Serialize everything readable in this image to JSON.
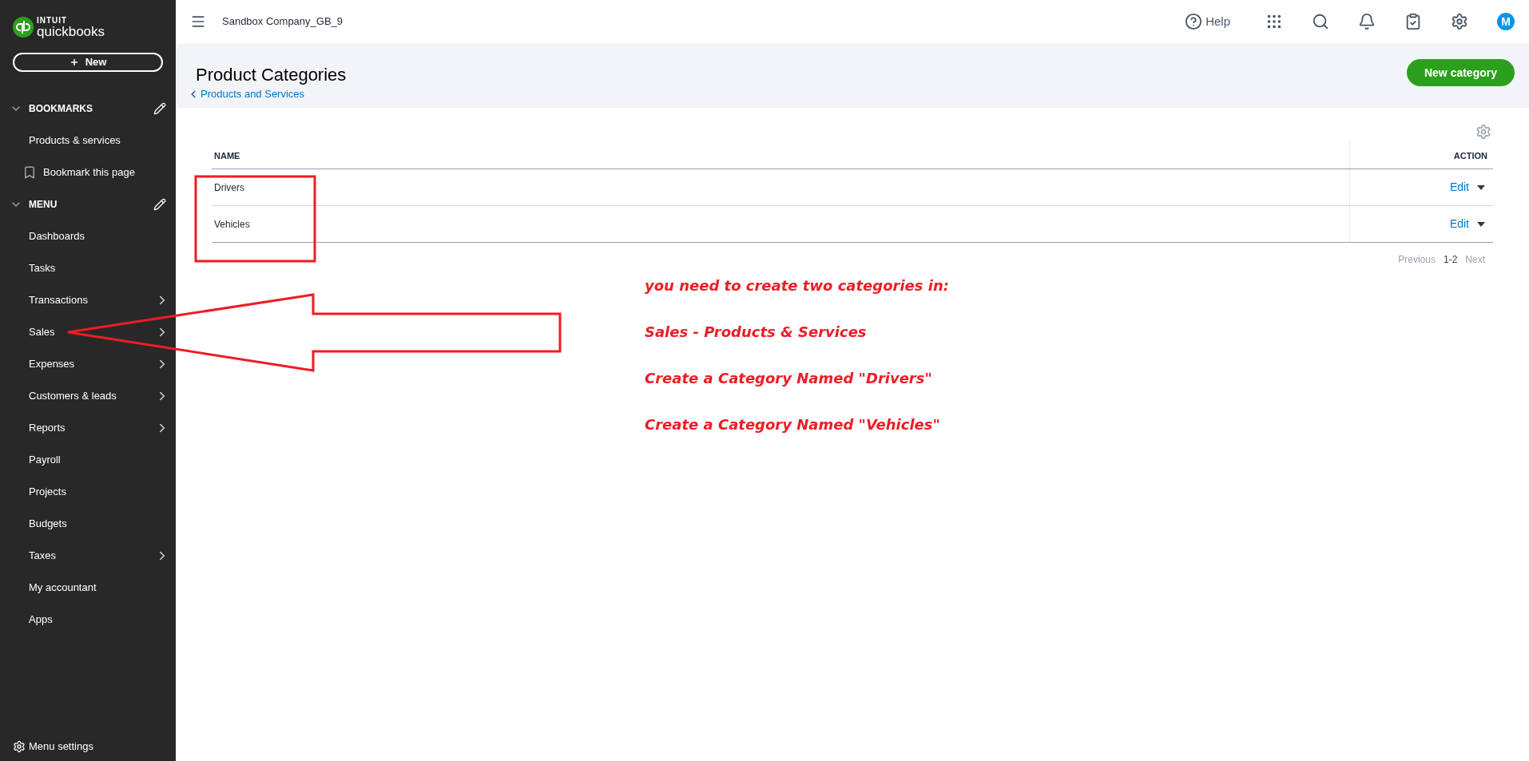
{
  "sidebar": {
    "logo": {
      "brand_top": "INTUIT",
      "brand": "quickbooks"
    },
    "new_button": "New",
    "bookmarks": {
      "title": "BOOKMARKS",
      "expanded": true,
      "items": [
        "Products & services"
      ],
      "bookmark_action": "Bookmark this page"
    },
    "menu": {
      "title": "MENU",
      "expanded": true,
      "items": [
        {
          "label": "Dashboards",
          "expandable": false
        },
        {
          "label": "Tasks",
          "expandable": false
        },
        {
          "label": "Transactions",
          "expandable": true
        },
        {
          "label": "Sales",
          "expandable": true
        },
        {
          "label": "Expenses",
          "expandable": true
        },
        {
          "label": "Customers & leads",
          "expandable": true
        },
        {
          "label": "Reports",
          "expandable": true
        },
        {
          "label": "Payroll",
          "expandable": false
        },
        {
          "label": "Projects",
          "expandable": false
        },
        {
          "label": "Budgets",
          "expandable": false
        },
        {
          "label": "Taxes",
          "expandable": true
        },
        {
          "label": "My accountant",
          "expandable": false
        },
        {
          "label": "Apps",
          "expandable": false
        }
      ]
    },
    "menu_settings": "Menu settings"
  },
  "top_bar": {
    "company": "Sandbox Company_GB_9",
    "help": "Help",
    "avatar": "M"
  },
  "page": {
    "title": "Product Categories",
    "back_link": "Products and Services",
    "new_button": "New category"
  },
  "table": {
    "columns": [
      "NAME",
      "ACTION"
    ],
    "rows": [
      {
        "name": "Drivers",
        "action": "Edit"
      },
      {
        "name": "Vehicles",
        "action": "Edit"
      }
    ]
  },
  "pagination": {
    "previous": "Previous",
    "range": "1-2",
    "next": "Next"
  },
  "annotation": {
    "lines": [
      "you need to create two categories in:",
      "Sales - Products & Services",
      "Create a Category Named \"Drivers\"",
      "Create a Category Named \"Vehicles\""
    ]
  }
}
